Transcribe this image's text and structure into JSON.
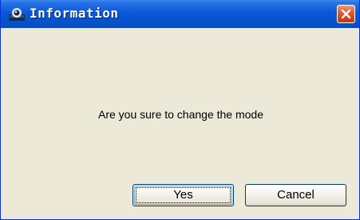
{
  "window": {
    "title": "Information",
    "icon": "app-icon",
    "close_icon": "close-icon"
  },
  "dialog": {
    "message": "Are you sure to change the mode"
  },
  "buttons": {
    "yes_label": "Yes",
    "cancel_label": "Cancel"
  },
  "colors": {
    "titlebar": "#0552c9",
    "close_button": "#d3431f",
    "dialog_background": "#ece9d8",
    "button_border": "#003c74"
  }
}
